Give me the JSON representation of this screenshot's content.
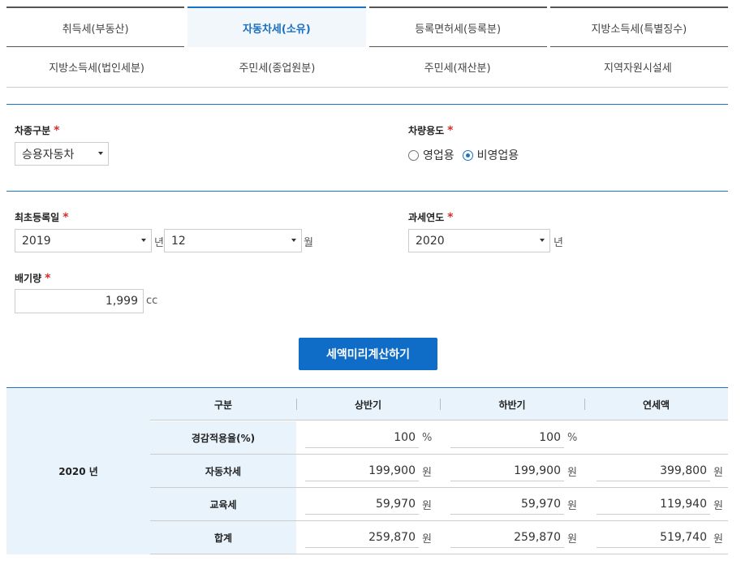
{
  "tabs_row1": [
    "취득세(부동산)",
    "자동차세(소유)",
    "등록면허세(등록분)",
    "지방소득세(특별징수)"
  ],
  "tabs_row2": [
    "지방소득세(법인세분)",
    "주민세(종업원분)",
    "주민세(재산분)",
    "지역자원시설세"
  ],
  "form": {
    "vehicle_type_label": "차종구분",
    "vehicle_type_value": "승용자동차",
    "vehicle_use_label": "차량용도",
    "use_business": "영업용",
    "use_nonbusiness": "비영업용",
    "first_reg_label": "최초등록일",
    "first_reg_year": "2019",
    "year_unit": "년",
    "first_reg_month": "12",
    "month_unit": "월",
    "tax_year_label": "과세연도",
    "tax_year_value": "2020",
    "tax_year_unit": "년",
    "displacement_label": "배기량",
    "displacement_value": "1,999",
    "displacement_unit": "cc",
    "required_mark": "*",
    "calc_button": "세액미리계산하기"
  },
  "result": {
    "year": "2020 년",
    "headers": [
      "구분",
      "상반기",
      "하반기",
      "연세액"
    ],
    "rows": [
      {
        "label": "경감적용율(%)",
        "first": "100",
        "second": "100",
        "annual": "",
        "unit": "%"
      },
      {
        "label": "자동차세",
        "first": "199,900",
        "second": "199,900",
        "annual": "399,800",
        "unit": "원"
      },
      {
        "label": "교육세",
        "first": "59,970",
        "second": "59,970",
        "annual": "119,940",
        "unit": "원"
      },
      {
        "label": "합계",
        "first": "259,870",
        "second": "259,870",
        "annual": "519,740",
        "unit": "원"
      }
    ]
  },
  "colors": {
    "accent": "#1a73c8",
    "button": "#0f6dc7",
    "header_bg": "#e8f3fc",
    "required": "#d32f2f"
  }
}
